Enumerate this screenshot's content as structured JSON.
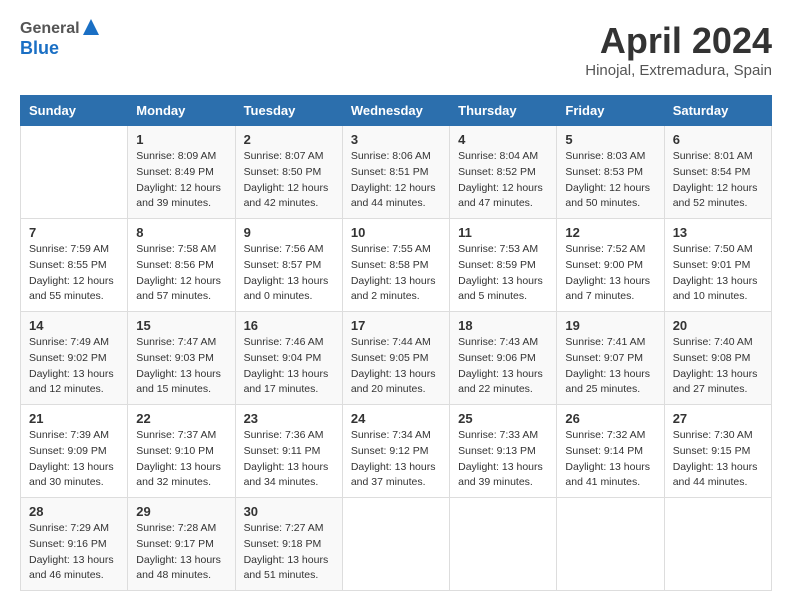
{
  "header": {
    "logo_general": "General",
    "logo_blue": "Blue",
    "month_title": "April 2024",
    "subtitle": "Hinojal, Extremadura, Spain"
  },
  "days_of_week": [
    "Sunday",
    "Monday",
    "Tuesday",
    "Wednesday",
    "Thursday",
    "Friday",
    "Saturday"
  ],
  "weeks": [
    [
      {
        "day": "",
        "info": ""
      },
      {
        "day": "1",
        "info": "Sunrise: 8:09 AM\nSunset: 8:49 PM\nDaylight: 12 hours\nand 39 minutes."
      },
      {
        "day": "2",
        "info": "Sunrise: 8:07 AM\nSunset: 8:50 PM\nDaylight: 12 hours\nand 42 minutes."
      },
      {
        "day": "3",
        "info": "Sunrise: 8:06 AM\nSunset: 8:51 PM\nDaylight: 12 hours\nand 44 minutes."
      },
      {
        "day": "4",
        "info": "Sunrise: 8:04 AM\nSunset: 8:52 PM\nDaylight: 12 hours\nand 47 minutes."
      },
      {
        "day": "5",
        "info": "Sunrise: 8:03 AM\nSunset: 8:53 PM\nDaylight: 12 hours\nand 50 minutes."
      },
      {
        "day": "6",
        "info": "Sunrise: 8:01 AM\nSunset: 8:54 PM\nDaylight: 12 hours\nand 52 minutes."
      }
    ],
    [
      {
        "day": "7",
        "info": "Sunrise: 7:59 AM\nSunset: 8:55 PM\nDaylight: 12 hours\nand 55 minutes."
      },
      {
        "day": "8",
        "info": "Sunrise: 7:58 AM\nSunset: 8:56 PM\nDaylight: 12 hours\nand 57 minutes."
      },
      {
        "day": "9",
        "info": "Sunrise: 7:56 AM\nSunset: 8:57 PM\nDaylight: 13 hours\nand 0 minutes."
      },
      {
        "day": "10",
        "info": "Sunrise: 7:55 AM\nSunset: 8:58 PM\nDaylight: 13 hours\nand 2 minutes."
      },
      {
        "day": "11",
        "info": "Sunrise: 7:53 AM\nSunset: 8:59 PM\nDaylight: 13 hours\nand 5 minutes."
      },
      {
        "day": "12",
        "info": "Sunrise: 7:52 AM\nSunset: 9:00 PM\nDaylight: 13 hours\nand 7 minutes."
      },
      {
        "day": "13",
        "info": "Sunrise: 7:50 AM\nSunset: 9:01 PM\nDaylight: 13 hours\nand 10 minutes."
      }
    ],
    [
      {
        "day": "14",
        "info": "Sunrise: 7:49 AM\nSunset: 9:02 PM\nDaylight: 13 hours\nand 12 minutes."
      },
      {
        "day": "15",
        "info": "Sunrise: 7:47 AM\nSunset: 9:03 PM\nDaylight: 13 hours\nand 15 minutes."
      },
      {
        "day": "16",
        "info": "Sunrise: 7:46 AM\nSunset: 9:04 PM\nDaylight: 13 hours\nand 17 minutes."
      },
      {
        "day": "17",
        "info": "Sunrise: 7:44 AM\nSunset: 9:05 PM\nDaylight: 13 hours\nand 20 minutes."
      },
      {
        "day": "18",
        "info": "Sunrise: 7:43 AM\nSunset: 9:06 PM\nDaylight: 13 hours\nand 22 minutes."
      },
      {
        "day": "19",
        "info": "Sunrise: 7:41 AM\nSunset: 9:07 PM\nDaylight: 13 hours\nand 25 minutes."
      },
      {
        "day": "20",
        "info": "Sunrise: 7:40 AM\nSunset: 9:08 PM\nDaylight: 13 hours\nand 27 minutes."
      }
    ],
    [
      {
        "day": "21",
        "info": "Sunrise: 7:39 AM\nSunset: 9:09 PM\nDaylight: 13 hours\nand 30 minutes."
      },
      {
        "day": "22",
        "info": "Sunrise: 7:37 AM\nSunset: 9:10 PM\nDaylight: 13 hours\nand 32 minutes."
      },
      {
        "day": "23",
        "info": "Sunrise: 7:36 AM\nSunset: 9:11 PM\nDaylight: 13 hours\nand 34 minutes."
      },
      {
        "day": "24",
        "info": "Sunrise: 7:34 AM\nSunset: 9:12 PM\nDaylight: 13 hours\nand 37 minutes."
      },
      {
        "day": "25",
        "info": "Sunrise: 7:33 AM\nSunset: 9:13 PM\nDaylight: 13 hours\nand 39 minutes."
      },
      {
        "day": "26",
        "info": "Sunrise: 7:32 AM\nSunset: 9:14 PM\nDaylight: 13 hours\nand 41 minutes."
      },
      {
        "day": "27",
        "info": "Sunrise: 7:30 AM\nSunset: 9:15 PM\nDaylight: 13 hours\nand 44 minutes."
      }
    ],
    [
      {
        "day": "28",
        "info": "Sunrise: 7:29 AM\nSunset: 9:16 PM\nDaylight: 13 hours\nand 46 minutes."
      },
      {
        "day": "29",
        "info": "Sunrise: 7:28 AM\nSunset: 9:17 PM\nDaylight: 13 hours\nand 48 minutes."
      },
      {
        "day": "30",
        "info": "Sunrise: 7:27 AM\nSunset: 9:18 PM\nDaylight: 13 hours\nand 51 minutes."
      },
      {
        "day": "",
        "info": ""
      },
      {
        "day": "",
        "info": ""
      },
      {
        "day": "",
        "info": ""
      },
      {
        "day": "",
        "info": ""
      }
    ]
  ]
}
